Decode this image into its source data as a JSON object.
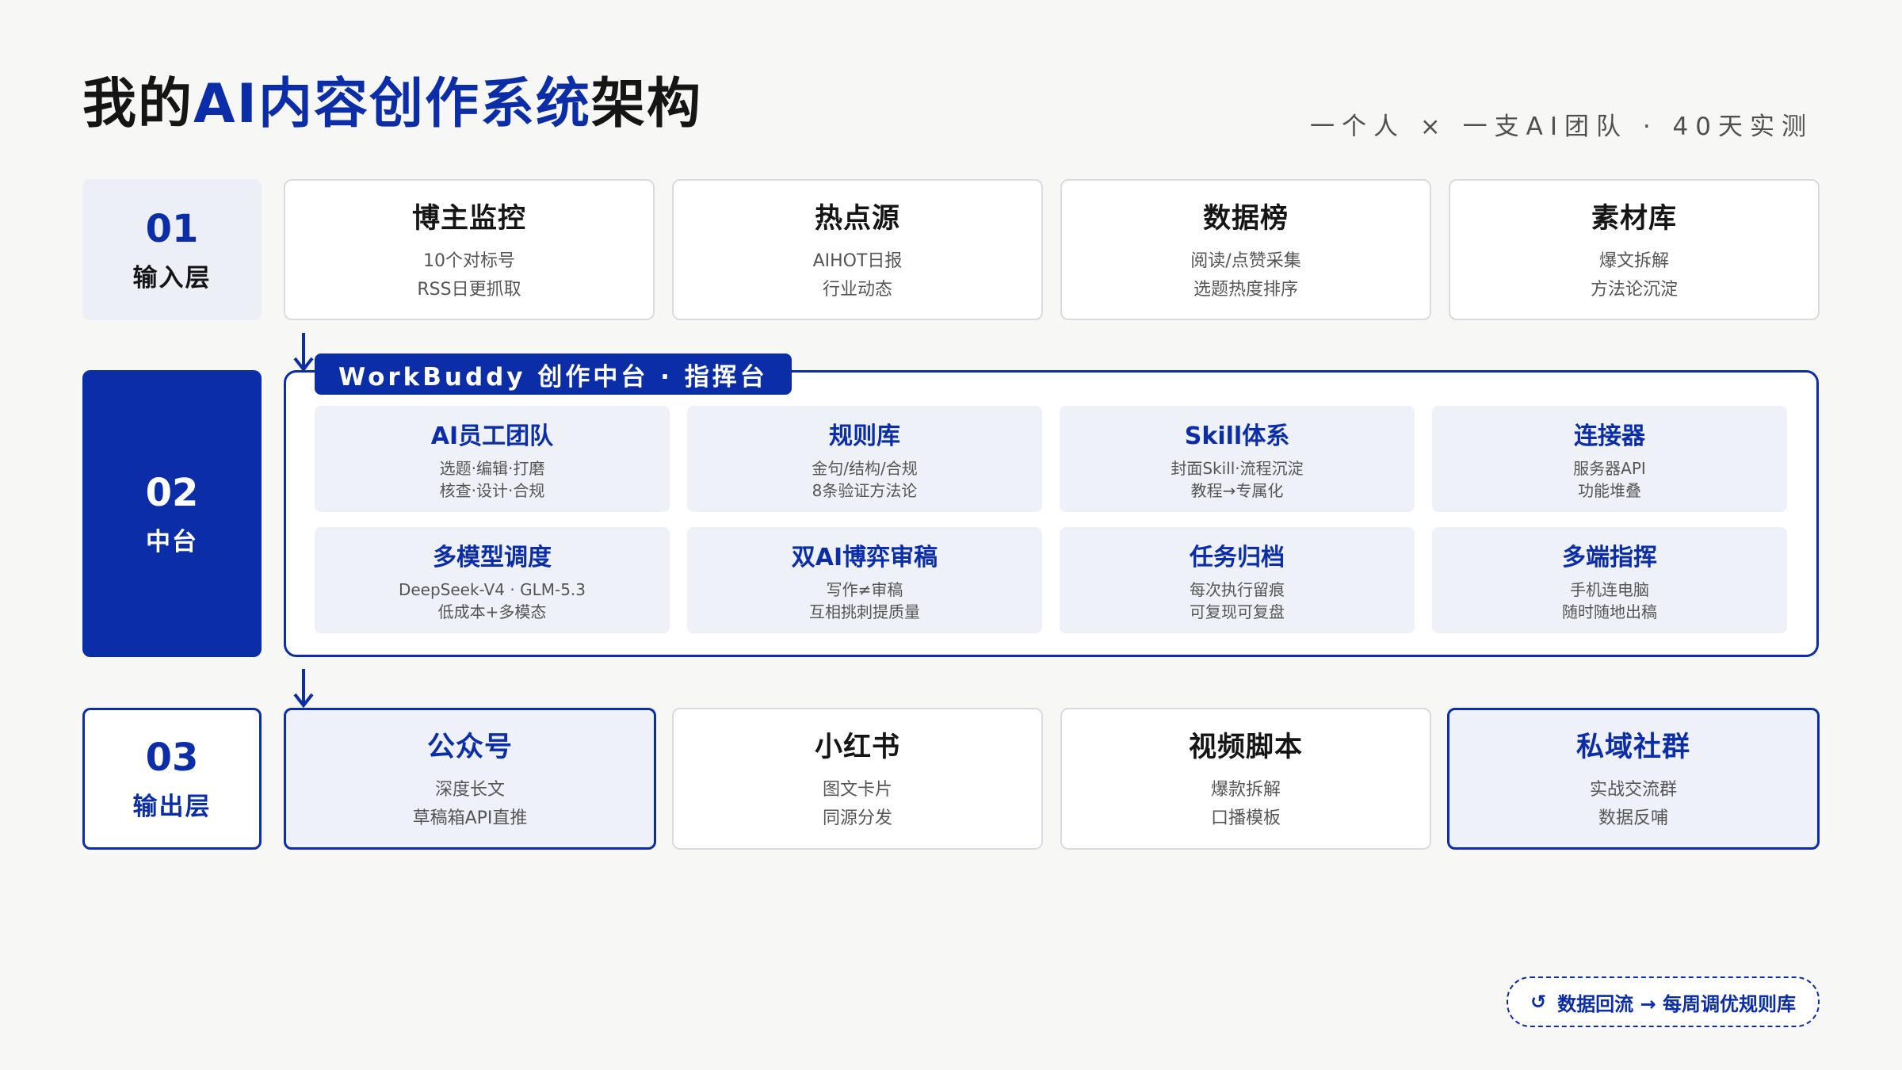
{
  "title": {
    "prefix": "我的",
    "accent": "AI内容创作系统",
    "suffix": "架构"
  },
  "subtitle": "一个人 × 一支AI团队 · 40天实测",
  "layers": [
    {
      "num": "01",
      "name": "输入层"
    },
    {
      "num": "02",
      "name": "中台"
    },
    {
      "num": "03",
      "name": "输出层"
    }
  ],
  "input_cards": [
    {
      "title": "博主监控",
      "lines": [
        "10个对标号",
        "RSS日更抓取"
      ]
    },
    {
      "title": "热点源",
      "lines": [
        "AIHOT日报",
        "行业动态"
      ]
    },
    {
      "title": "数据榜",
      "lines": [
        "阅读/点赞采集",
        "选题热度排序"
      ]
    },
    {
      "title": "素材库",
      "lines": [
        "爆文拆解",
        "方法论沉淀"
      ]
    }
  ],
  "hub": {
    "tag": "WorkBuddy 创作中台 · 指挥台",
    "modules": [
      {
        "title": "AI员工团队",
        "lines": [
          "选题·编辑·打磨",
          "核查·设计·合规"
        ]
      },
      {
        "title": "规则库",
        "lines": [
          "金句/结构/合规",
          "8条验证方法论"
        ]
      },
      {
        "title": "Skill体系",
        "lines": [
          "封面Skill·流程沉淀",
          "教程→专属化"
        ]
      },
      {
        "title": "连接器",
        "lines": [
          "服务器API",
          "功能堆叠"
        ]
      },
      {
        "title": "多模型调度",
        "lines": [
          "DeepSeek-V4 · GLM-5.3",
          "低成本+多模态"
        ]
      },
      {
        "title": "双AI博弈审稿",
        "lines": [
          "写作≠审稿",
          "互相挑刺提质量"
        ]
      },
      {
        "title": "任务归档",
        "lines": [
          "每次执行留痕",
          "可复现可复盘"
        ]
      },
      {
        "title": "多端指挥",
        "lines": [
          "手机连电脑",
          "随时随地出稿"
        ]
      }
    ]
  },
  "output_cards": [
    {
      "title": "公众号",
      "lines": [
        "深度长文",
        "草稿箱API直推"
      ],
      "highlight": true
    },
    {
      "title": "小红书",
      "lines": [
        "图文卡片",
        "同源分发"
      ],
      "highlight": false
    },
    {
      "title": "视频脚本",
      "lines": [
        "爆款拆解",
        "口播模板"
      ],
      "highlight": false
    },
    {
      "title": "私域社群",
      "lines": [
        "实战交流群",
        "数据反哺"
      ],
      "highlight": true
    }
  ],
  "feedback": {
    "icon": "↺",
    "text": "数据回流 → 每周调优规则库"
  },
  "colors": {
    "accent": "#0b2da8",
    "module_bg": "#eef1f8",
    "page_bg": "#f7f7f6"
  }
}
